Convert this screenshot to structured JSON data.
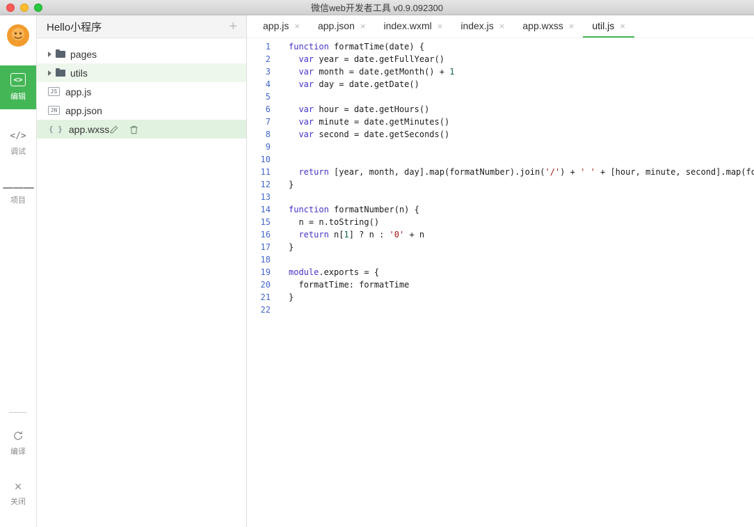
{
  "window": {
    "title": "微信web开发者工具 v0.9.092300"
  },
  "colors": {
    "accent_green": "#43b656",
    "keyword": "#4333c4",
    "string": "#a31515",
    "number": "#116644",
    "line_number": "#4266c9",
    "selected_row": "#e2f2e0",
    "tinted_row": "#eef7ec"
  },
  "icons": {
    "tab_close": "×",
    "edit": "<>",
    "debug": "</>",
    "close": "×"
  },
  "sidebar": {
    "items": [
      {
        "id": "edit",
        "label": "编辑",
        "icon": "code",
        "active": true
      },
      {
        "id": "debug",
        "label": "调试",
        "icon": "debug",
        "active": false
      },
      {
        "id": "project",
        "label": "项目",
        "icon": "menu",
        "active": false
      }
    ],
    "bottom_items": [
      {
        "id": "compile",
        "label": "编译",
        "icon": "compile",
        "active": false
      },
      {
        "id": "close",
        "label": "关闭",
        "icon": "close",
        "active": false
      }
    ]
  },
  "explorer": {
    "title": "Hello小程序",
    "add_label": "+",
    "items": [
      {
        "kind": "folder",
        "label": "pages"
      },
      {
        "kind": "folder",
        "label": "utils",
        "tinted": true
      },
      {
        "kind": "file",
        "badge": "JS",
        "label": "app.js"
      },
      {
        "kind": "file",
        "badge": "JN",
        "label": "app.json"
      },
      {
        "kind": "file",
        "badge": "{}",
        "label": "app.wxss",
        "selected": true
      }
    ]
  },
  "tabs": [
    {
      "label": "app.js",
      "active": false
    },
    {
      "label": "app.json",
      "active": false
    },
    {
      "label": "index.wxml",
      "active": false
    },
    {
      "label": "index.js",
      "active": false
    },
    {
      "label": "app.wxss",
      "active": false
    },
    {
      "label": "util.js",
      "active": true
    }
  ],
  "editor": {
    "lines": [
      {
        "n": "1",
        "tokens": [
          [
            "kw",
            "function"
          ],
          [
            "p",
            " formatTime(date) {"
          ]
        ]
      },
      {
        "n": "2",
        "tokens": [
          [
            "p",
            "  "
          ],
          [
            "kw",
            "var"
          ],
          [
            "p",
            " year = date.getFullYear()"
          ]
        ]
      },
      {
        "n": "3",
        "tokens": [
          [
            "p",
            "  "
          ],
          [
            "kw",
            "var"
          ],
          [
            "p",
            " month = date.getMonth() + "
          ],
          [
            "num",
            "1"
          ]
        ]
      },
      {
        "n": "4",
        "tokens": [
          [
            "p",
            "  "
          ],
          [
            "kw",
            "var"
          ],
          [
            "p",
            " day = date.getDate()"
          ]
        ]
      },
      {
        "n": "5",
        "tokens": []
      },
      {
        "n": "6",
        "tokens": [
          [
            "p",
            "  "
          ],
          [
            "kw",
            "var"
          ],
          [
            "p",
            " hour = date.getHours()"
          ]
        ]
      },
      {
        "n": "7",
        "tokens": [
          [
            "p",
            "  "
          ],
          [
            "kw",
            "var"
          ],
          [
            "p",
            " minute = date.getMinutes()"
          ]
        ]
      },
      {
        "n": "8",
        "tokens": [
          [
            "p",
            "  "
          ],
          [
            "kw",
            "var"
          ],
          [
            "p",
            " second = date.getSeconds()"
          ]
        ]
      },
      {
        "n": "9",
        "tokens": []
      },
      {
        "n": "10",
        "tokens": []
      },
      {
        "n": "11",
        "tokens": [
          [
            "p",
            "  "
          ],
          [
            "kw",
            "return"
          ],
          [
            "p",
            " [year, month, day].map(formatNumber).join("
          ],
          [
            "str",
            "'/'"
          ],
          [
            "p",
            ") + "
          ],
          [
            "str",
            "' '"
          ],
          [
            "p",
            " + [hour, minute, second].map(formatNumber).join("
          ],
          [
            "str",
            "':'"
          ],
          [
            "p",
            ")"
          ]
        ]
      },
      {
        "n": "12",
        "tokens": [
          [
            "p",
            "}"
          ]
        ]
      },
      {
        "n": "13",
        "tokens": []
      },
      {
        "n": "14",
        "tokens": [
          [
            "kw",
            "function"
          ],
          [
            "p",
            " formatNumber(n) {"
          ]
        ]
      },
      {
        "n": "15",
        "tokens": [
          [
            "p",
            "  n = n.toString()"
          ]
        ]
      },
      {
        "n": "16",
        "tokens": [
          [
            "p",
            "  "
          ],
          [
            "kw",
            "return"
          ],
          [
            "p",
            " n["
          ],
          [
            "num",
            "1"
          ],
          [
            "p",
            "] ? n : "
          ],
          [
            "str",
            "'0'"
          ],
          [
            "p",
            " + n"
          ]
        ]
      },
      {
        "n": "17",
        "tokens": [
          [
            "p",
            "}"
          ]
        ]
      },
      {
        "n": "18",
        "tokens": []
      },
      {
        "n": "19",
        "tokens": [
          [
            "kw",
            "module"
          ],
          [
            "p",
            ".exports = {"
          ]
        ]
      },
      {
        "n": "20",
        "tokens": [
          [
            "p",
            "  formatTime: formatTime"
          ]
        ]
      },
      {
        "n": "21",
        "tokens": [
          [
            "p",
            "}"
          ]
        ]
      },
      {
        "n": "22",
        "tokens": []
      }
    ]
  }
}
